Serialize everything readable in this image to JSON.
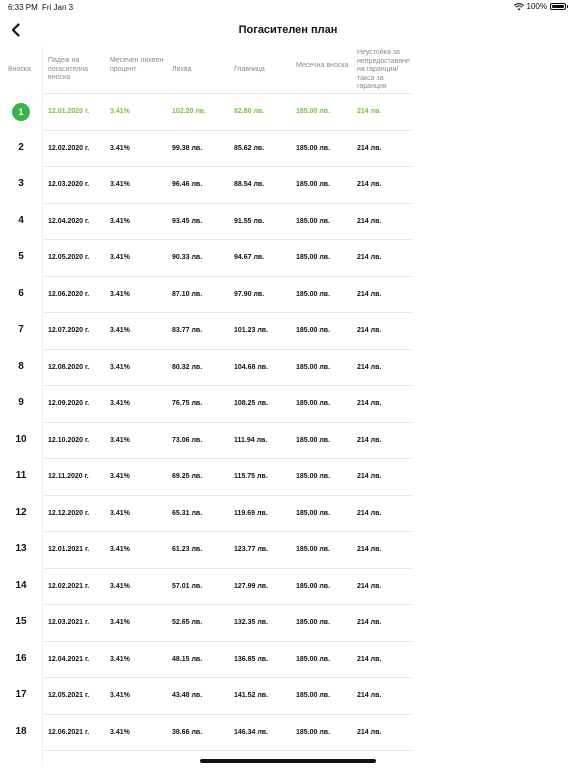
{
  "status_bar": {
    "time": "6:33 PM",
    "date": "Fri Jan 3",
    "battery": "100%"
  },
  "nav": {
    "title": "Погасителен план"
  },
  "table": {
    "headers": {
      "installment": "Вноска",
      "due_date": "Падеж на погасителна вноска",
      "monthly_rate": "Месечен лихвен процент",
      "interest": "Лихва",
      "principal": "Главница",
      "monthly_payment": "Месечна вноска",
      "guarantee_fee": "Неустойка за непредоставяне на гаранция/ такса за гаранция"
    },
    "rows": [
      {
        "n": "1",
        "date": "12.01.2020 г.",
        "rate": "3.41%",
        "interest": "102.20 лв.",
        "principal": "82.80 лв.",
        "payment": "185.00 лв.",
        "fee": "214 лв."
      },
      {
        "n": "2",
        "date": "12.02.2020 г.",
        "rate": "3.41%",
        "interest": "99.38 лв.",
        "principal": "85.62 лв.",
        "payment": "185.00 лв.",
        "fee": "214 лв."
      },
      {
        "n": "3",
        "date": "12.03.2020 г.",
        "rate": "3.41%",
        "interest": "96.46 лв.",
        "principal": "88.54 лв.",
        "payment": "185.00 лв.",
        "fee": "214 лв."
      },
      {
        "n": "4",
        "date": "12.04.2020 г.",
        "rate": "3.41%",
        "interest": "93.45 лв.",
        "principal": "91.55 лв.",
        "payment": "185.00 лв.",
        "fee": "214 лв."
      },
      {
        "n": "5",
        "date": "12.05.2020 г.",
        "rate": "3.41%",
        "interest": "90.33 лв.",
        "principal": "94.67 лв.",
        "payment": "185.00 лв.",
        "fee": "214 лв."
      },
      {
        "n": "6",
        "date": "12.06.2020 г.",
        "rate": "3.41%",
        "interest": "87.10 лв.",
        "principal": "97.90 лв.",
        "payment": "185.00 лв.",
        "fee": "214 лв."
      },
      {
        "n": "7",
        "date": "12.07.2020 г.",
        "rate": "3.41%",
        "interest": "83.77 лв.",
        "principal": "101.23 лв.",
        "payment": "185.00 лв.",
        "fee": "214 лв."
      },
      {
        "n": "8",
        "date": "12.08.2020 г.",
        "rate": "3.41%",
        "interest": "80.32 лв.",
        "principal": "104.68 лв.",
        "payment": "185.00 лв.",
        "fee": "214 лв."
      },
      {
        "n": "9",
        "date": "12.09.2020 г.",
        "rate": "3.41%",
        "interest": "76.75 лв.",
        "principal": "108.25 лв.",
        "payment": "185.00 лв.",
        "fee": "214 лв."
      },
      {
        "n": "10",
        "date": "12.10.2020 г.",
        "rate": "3.41%",
        "interest": "73.06 лв.",
        "principal": "111.94 лв.",
        "payment": "185.00 лв.",
        "fee": "214 лв."
      },
      {
        "n": "11",
        "date": "12.11.2020 г.",
        "rate": "3.41%",
        "interest": "69.25 лв.",
        "principal": "115.75 лв.",
        "payment": "185.00 лв.",
        "fee": "214 лв."
      },
      {
        "n": "12",
        "date": "12.12.2020 г.",
        "rate": "3.41%",
        "interest": "65.31 лв.",
        "principal": "119.69 лв.",
        "payment": "185.00 лв.",
        "fee": "214 лв."
      },
      {
        "n": "13",
        "date": "12.01.2021 г.",
        "rate": "3.41%",
        "interest": "61.23 лв.",
        "principal": "123.77 лв.",
        "payment": "185.00 лв.",
        "fee": "214 лв."
      },
      {
        "n": "14",
        "date": "12.02.2021 г.",
        "rate": "3.41%",
        "interest": "57.01 лв.",
        "principal": "127.99 лв.",
        "payment": "185.00 лв.",
        "fee": "214 лв."
      },
      {
        "n": "15",
        "date": "12.03.2021 г.",
        "rate": "3.41%",
        "interest": "52.65 лв.",
        "principal": "132.35 лв.",
        "payment": "185.00 лв.",
        "fee": "214 лв."
      },
      {
        "n": "16",
        "date": "12.04.2021 г.",
        "rate": "3.41%",
        "interest": "48.15 лв.",
        "principal": "136.85 лв.",
        "payment": "185.00 лв.",
        "fee": "214 лв."
      },
      {
        "n": "17",
        "date": "12.05.2021 г.",
        "rate": "3.41%",
        "interest": "43.48 лв.",
        "principal": "141.52 лв.",
        "payment": "185.00 лв.",
        "fee": "214 лв."
      },
      {
        "n": "18",
        "date": "12.06.2021 г.",
        "rate": "3.41%",
        "interest": "38.66 лв.",
        "principal": "146.34 лв.",
        "payment": "185.00 лв.",
        "fee": "214 лв."
      }
    ]
  },
  "colors": {
    "accent_green": "#3cb34a",
    "active_text_green": "#7cc242",
    "header_gray": "#8a8a8a"
  }
}
